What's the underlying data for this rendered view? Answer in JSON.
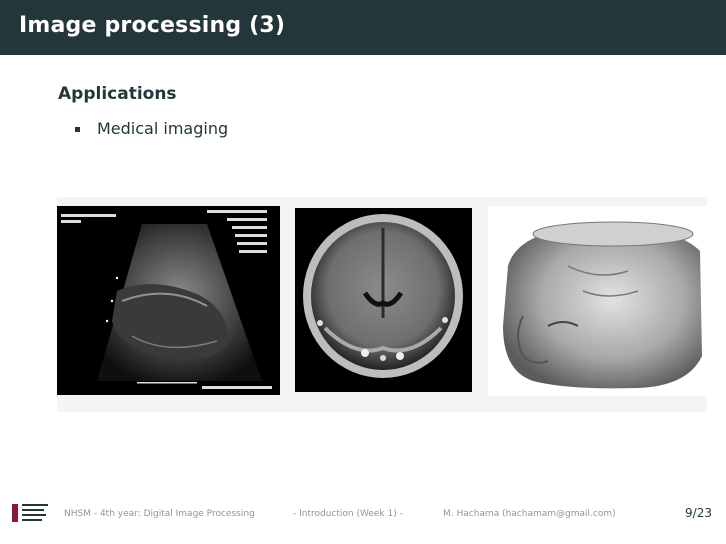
{
  "slide": {
    "title": "Image processing (3)",
    "heading": "Applications",
    "bullets": [
      "Medical imaging"
    ]
  },
  "footer": {
    "course": "NHSM - 4th year: Digital Image Processing",
    "section": "- Introduction (Week 1) -",
    "author": "M. Hachama (hachamam@gmail.com)",
    "page": "9/23"
  },
  "figures": [
    {
      "name": "ultrasound-image"
    },
    {
      "name": "brain-mri-image"
    },
    {
      "name": "head-3d-render-image"
    }
  ],
  "colors": {
    "title_bar": "#23373b",
    "text": "#23373b",
    "footer_text": "#8a979b",
    "figure_background": "#f4f4f4"
  }
}
